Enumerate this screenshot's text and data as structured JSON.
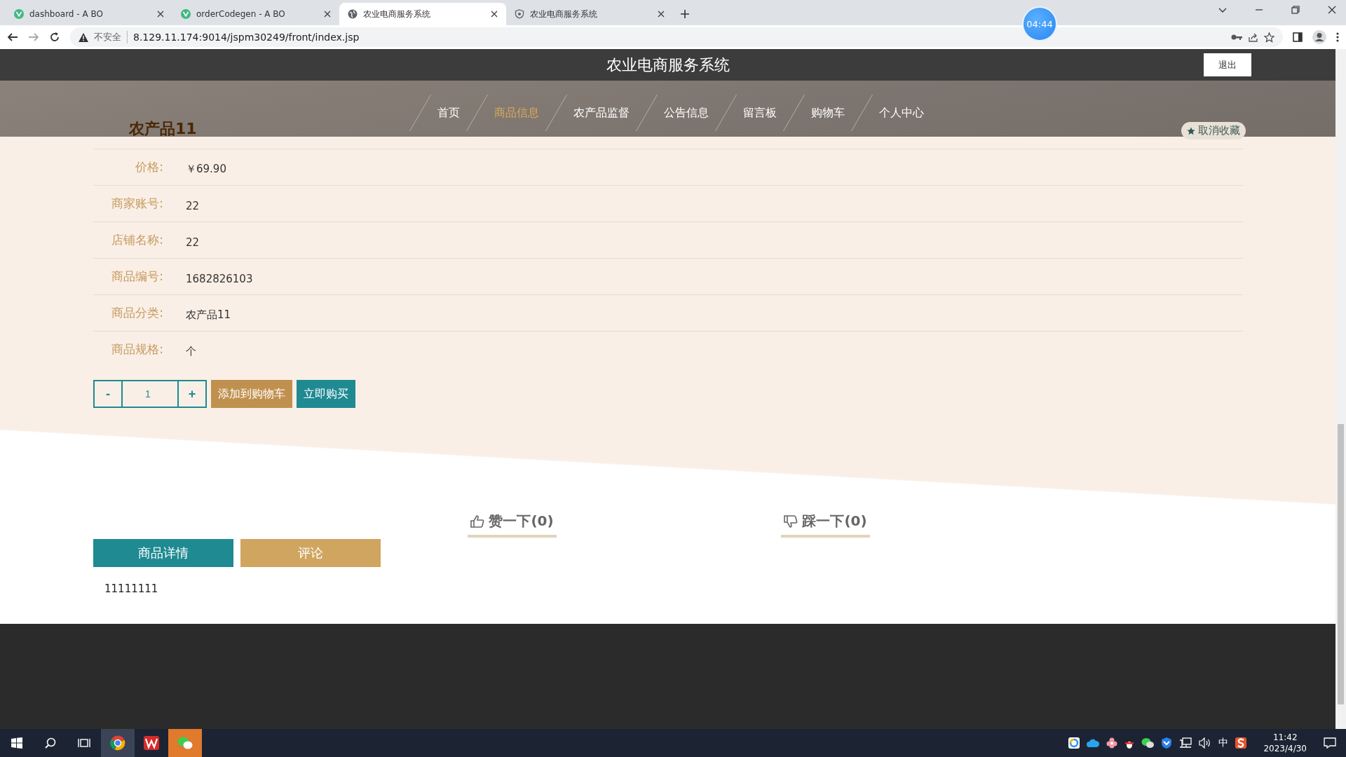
{
  "browser": {
    "tabs": [
      {
        "title": "dashboard - A BO",
        "kind": "vue",
        "selected": false
      },
      {
        "title": "orderCodegen - A BO",
        "kind": "vue",
        "selected": false
      },
      {
        "title": "农业电商服务系统",
        "kind": "globe",
        "selected": true
      },
      {
        "title": "农业电商服务系统",
        "kind": "shield",
        "selected": false
      }
    ],
    "security": "不安全",
    "url": "8.129.11.174:9014/jspm30249/front/index.jsp",
    "timer": "04:44"
  },
  "header": {
    "title": "农业电商服务系统",
    "logout": "退出"
  },
  "nav": [
    {
      "label": "首页",
      "selected": false
    },
    {
      "label": "商品信息",
      "selected": true
    },
    {
      "label": "农产品监督",
      "selected": false
    },
    {
      "label": "公告信息",
      "selected": false
    },
    {
      "label": "留言板",
      "selected": false
    },
    {
      "label": "购物车",
      "selected": false
    },
    {
      "label": "个人中心",
      "selected": false
    }
  ],
  "product": {
    "title": "农产品11",
    "favorite": "取消收藏",
    "fields": [
      {
        "label": "价格:",
        "value": "￥69.90"
      },
      {
        "label": "商家账号:",
        "value": "22"
      },
      {
        "label": "店铺名称:",
        "value": "22"
      },
      {
        "label": "商品编号:",
        "value": "1682826103"
      },
      {
        "label": "商品分类:",
        "value": "农产品11"
      },
      {
        "label": "商品规格:",
        "value": "个"
      }
    ],
    "minus": "-",
    "quantity": "1",
    "plus": "+",
    "add_to_cart": "添加到购物车",
    "buy_now": "立即购买"
  },
  "votes": [
    {
      "kind": "up",
      "label": "赞一下(0)"
    },
    {
      "kind": "down",
      "label": "踩一下(0)"
    }
  ],
  "detail_tabs": [
    {
      "label": "商品详情",
      "selected": true
    },
    {
      "label": "评论",
      "selected": false
    }
  ],
  "detail_text": "11111111",
  "taskbar": {
    "ime": "中",
    "time": "11:42",
    "date": "2023/4/30"
  }
}
